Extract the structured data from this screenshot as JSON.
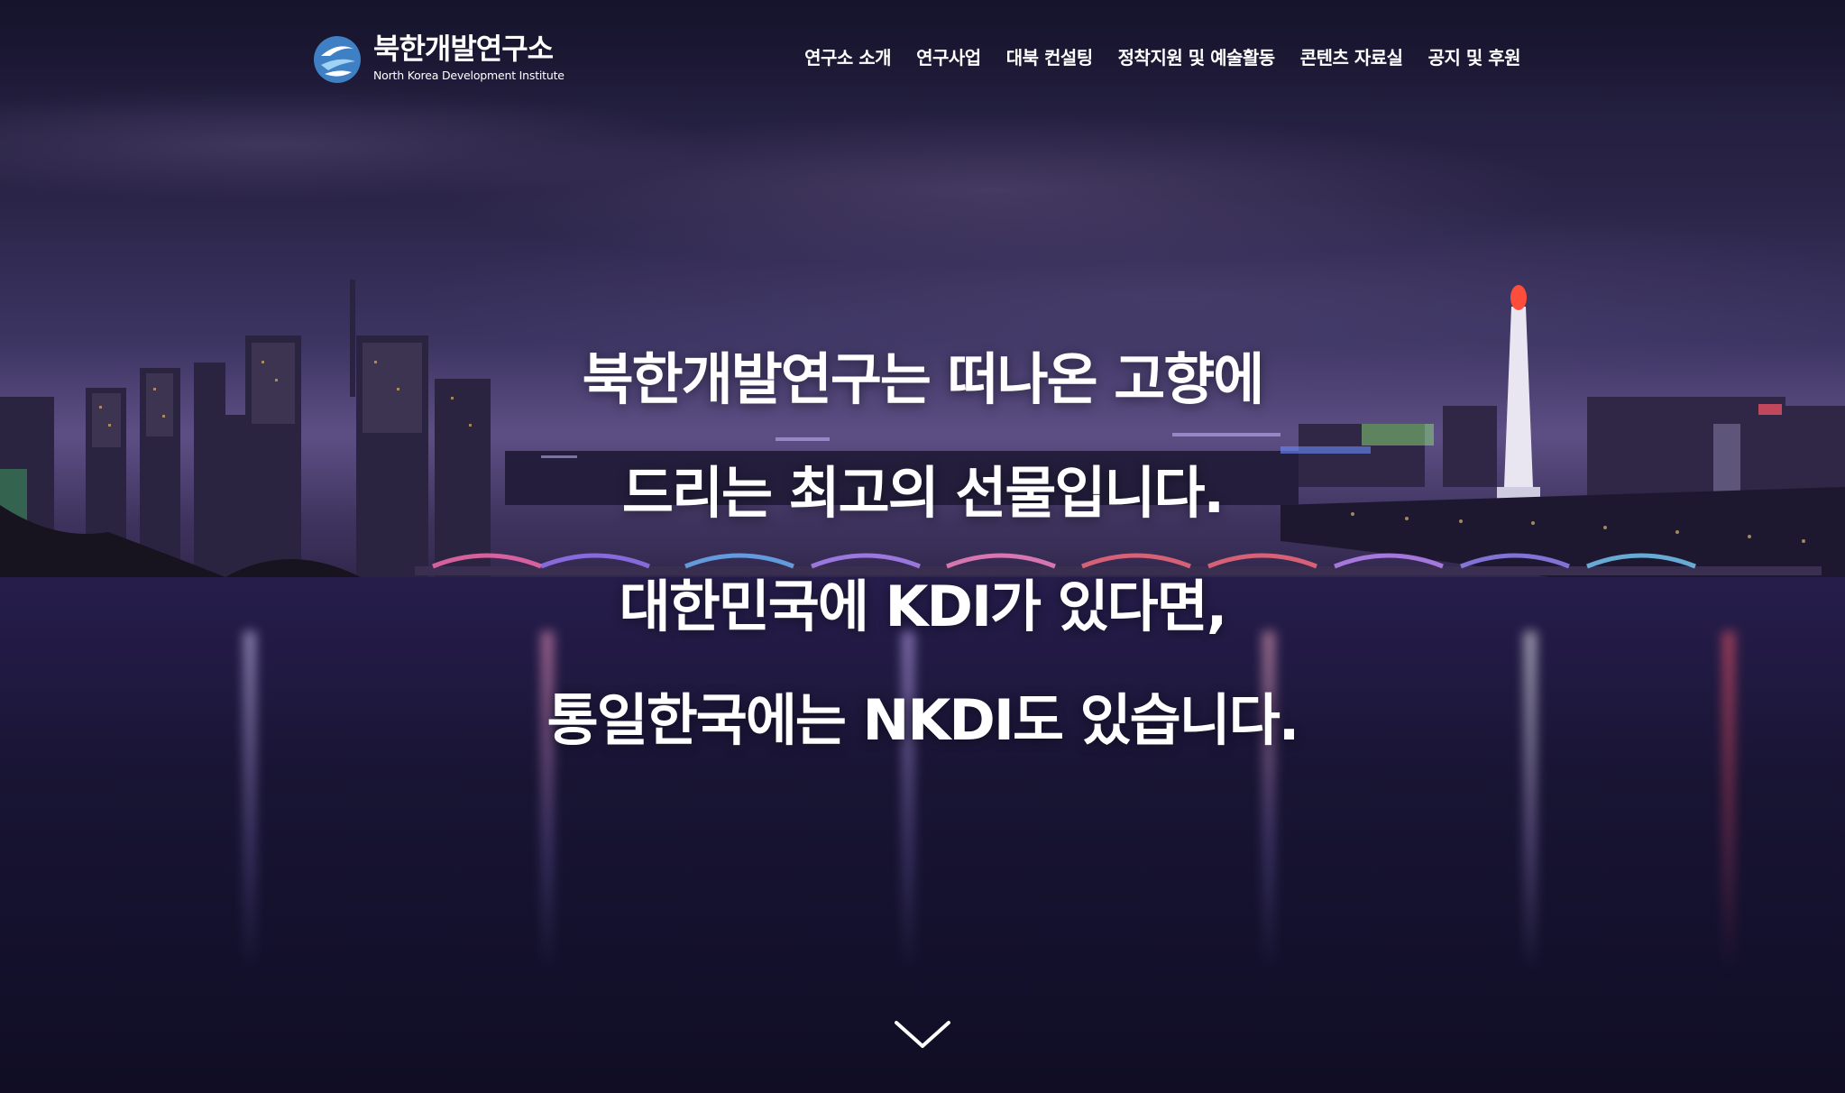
{
  "header": {
    "logo_korean": "북한개발연구소",
    "logo_english": "North Korea Development Institute",
    "nav": [
      {
        "label": "연구소 소개"
      },
      {
        "label": "연구사업"
      },
      {
        "label": "대북 컨설팅"
      },
      {
        "label": "정착지원 및 예술활동"
      },
      {
        "label": "콘텐츠 자료실"
      },
      {
        "label": "공지 및 후원"
      }
    ]
  },
  "hero": {
    "lines": [
      "북한개발연구는 떠나온 고향에",
      "드리는 최고의 선물입니다.",
      "대한민국에 KDI가 있다면,",
      "통일한국에는 NKDI도 있습니다."
    ],
    "scroll_icon": "chevron-down-icon"
  },
  "colors": {
    "text": "#ffffff",
    "logo_blue": "#4aa3d9",
    "night_sky": "#1c1936"
  }
}
